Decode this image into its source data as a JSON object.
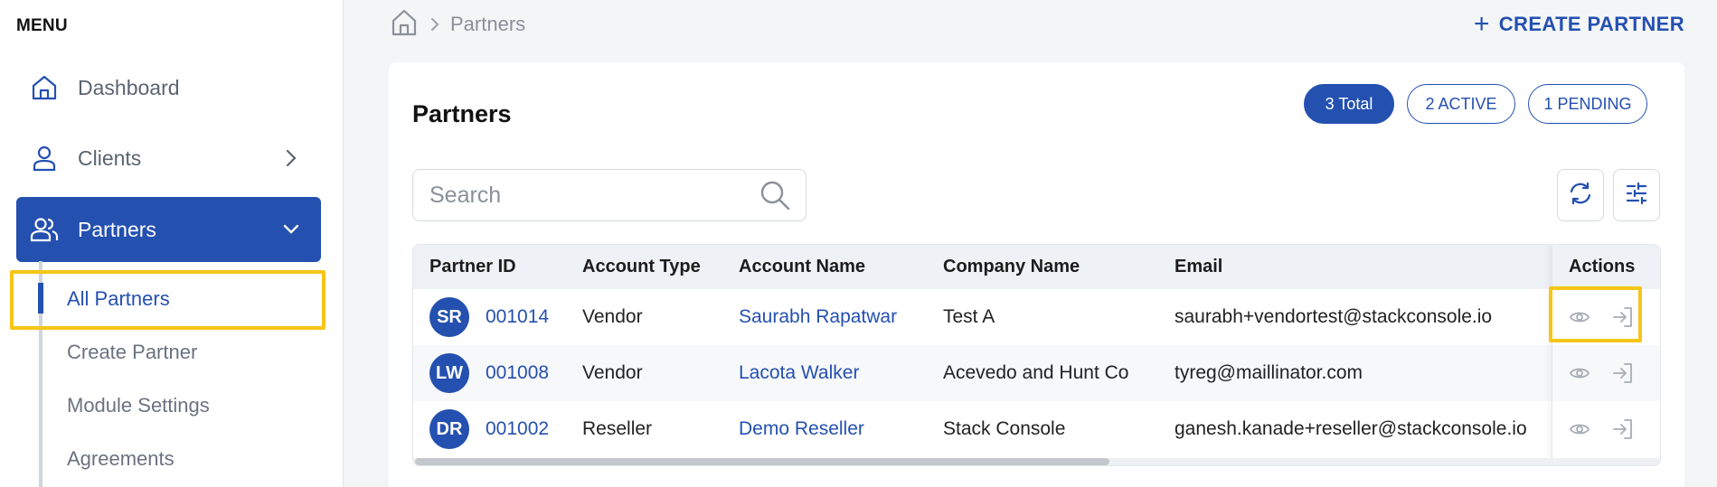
{
  "sidebar": {
    "menu_title": "MENU",
    "items": [
      {
        "label": "Dashboard",
        "icon": "home-icon"
      },
      {
        "label": "Clients",
        "icon": "user-icon"
      },
      {
        "label": "Partners",
        "icon": "users-icon"
      }
    ],
    "subitems": [
      {
        "label": "All Partners"
      },
      {
        "label": "Create Partner"
      },
      {
        "label": "Module Settings"
      },
      {
        "label": "Agreements"
      }
    ]
  },
  "breadcrumb": {
    "current": "Partners"
  },
  "header": {
    "create_label": "CREATE PARTNER"
  },
  "card": {
    "title": "Partners",
    "pills": {
      "total": "3 Total",
      "active": "2 ACTIVE",
      "pending": "1 PENDING"
    },
    "search_placeholder": "Search"
  },
  "table": {
    "headers": {
      "partner_id": "Partner ID",
      "account_type": "Account Type",
      "account_name": "Account Name",
      "company_name": "Company Name",
      "email": "Email",
      "actions": "Actions"
    },
    "rows": [
      {
        "initials": "SR",
        "partner_id": "001014",
        "account_type": "Vendor",
        "account_name": "Saurabh Rapatwar",
        "company_name": "Test A",
        "email": "saurabh+vendortest@stackconsole.io"
      },
      {
        "initials": "LW",
        "partner_id": "001008",
        "account_type": "Vendor",
        "account_name": "Lacota Walker",
        "company_name": "Acevedo and Hunt Co",
        "email": "tyreg@maillinator.com"
      },
      {
        "initials": "DR",
        "partner_id": "001002",
        "account_type": "Reseller",
        "account_name": "Demo Reseller",
        "company_name": "Stack Console",
        "email": "ganesh.kanade+reseller@stackconsole.io"
      }
    ]
  },
  "colors": {
    "accent": "#2450b0",
    "highlight": "#f5c518"
  }
}
